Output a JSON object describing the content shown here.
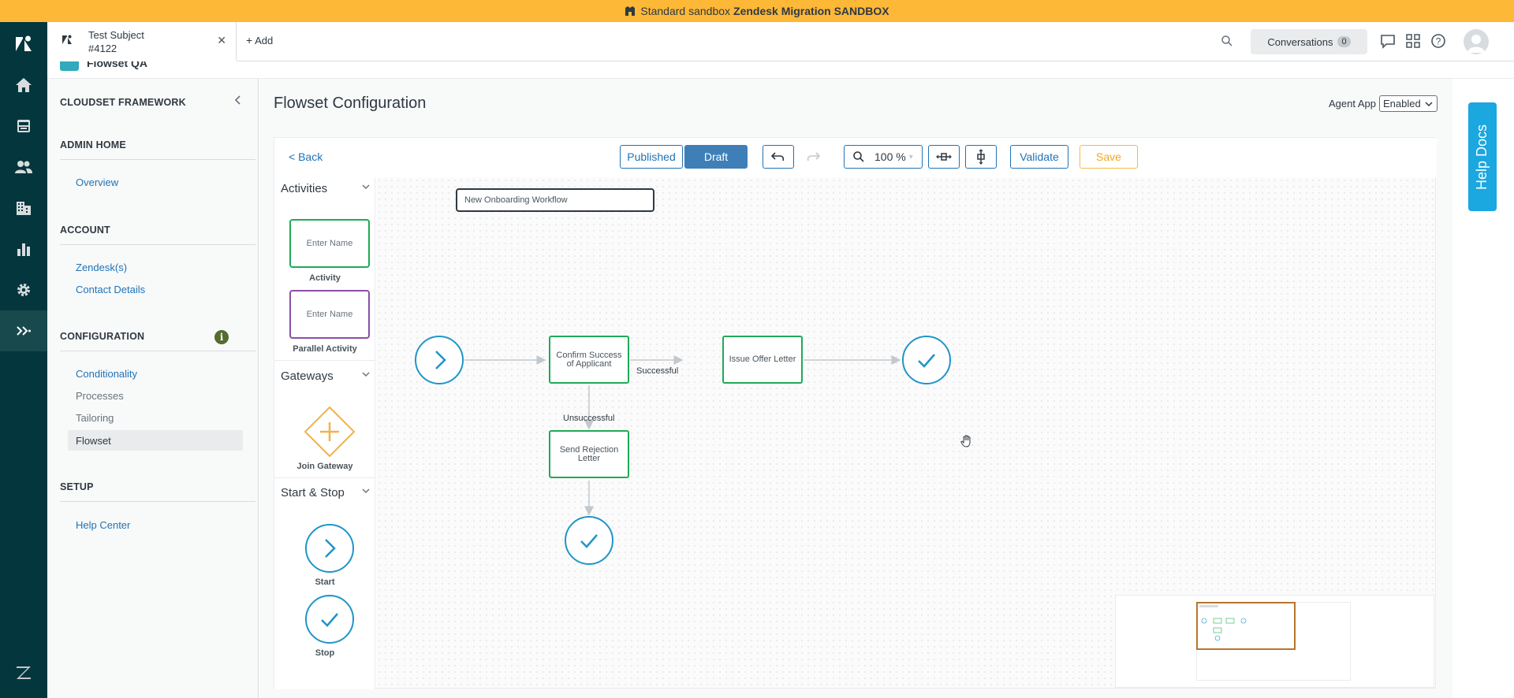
{
  "banner": {
    "prefix": "Standard sandbox",
    "name": "Zendesk Migration SANDBOX"
  },
  "header": {
    "ticket_title": "Test Subject",
    "ticket_number": "#4122",
    "add_label": "Add",
    "conversations_label": "Conversations",
    "conversations_count": "0"
  },
  "strip": {
    "app_name": "Flowset QA"
  },
  "sidebar": {
    "framework_title": "CLOUDSET FRAMEWORK",
    "admin_home": "ADMIN HOME",
    "overview": "Overview",
    "account": "ACCOUNT",
    "zendesks": "Zendesk(s)",
    "contact_details": "Contact Details",
    "configuration": "CONFIGURATION",
    "conditionality": "Conditionality",
    "processes": "Processes",
    "tailoring": "Tailoring",
    "flowset": "Flowset",
    "setup": "SETUP",
    "help_center": "Help Center"
  },
  "main": {
    "title": "Flowset Configuration",
    "agent_app_label": "Agent App",
    "agent_app_value": "Enabled"
  },
  "toolbar": {
    "back": "<  Back",
    "published": "Published",
    "draft": "Draft",
    "zoom": "100 %",
    "validate": "Validate",
    "save": "Save"
  },
  "palette": {
    "activities": "Activities",
    "activity_placeholder": "Enter Name",
    "activity_label": "Activity",
    "parallel_placeholder": "Enter Name",
    "parallel_label": "Parallel Activity",
    "gateways": "Gateways",
    "join_gateway_label": "Join Gateway",
    "start_stop": "Start & Stop",
    "start_label": "Start",
    "stop_label": "Stop"
  },
  "canvas": {
    "workflow_name": "New Onboarding Workflow",
    "task_confirm": "Confirm Success of Applicant",
    "task_offer": "Issue Offer Letter",
    "task_rejection": "Send Rejection Letter",
    "edge_successful": "Successful",
    "edge_unsuccessful": "Unsuccessful"
  },
  "help_docs": "Help Docs",
  "colors": {
    "banner": "#fdb838",
    "nav": "#03363d",
    "accent": "#1f73b7",
    "task_border": "#1faa56",
    "parallel_border": "#8b4fa6",
    "gateway": "#f0b34a",
    "event_blue": "#1f95c9",
    "save": "#f5a623",
    "help_docs": "#1ba7e0"
  }
}
